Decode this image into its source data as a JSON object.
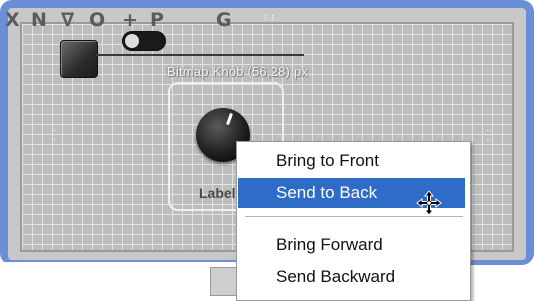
{
  "canvas": {
    "widget_caption": "Bitmap Knob (56,28) px",
    "knob_label": "Label"
  },
  "toolbar": {
    "tools": [
      "X",
      "N",
      "∇",
      "O",
      "+",
      "P",
      "G"
    ],
    "active_tool": "G"
  },
  "context_menu": {
    "items": [
      {
        "label": "Bring to Front"
      },
      {
        "label": "Send to Back"
      },
      {
        "label": "Bring Forward"
      },
      {
        "label": "Send Backward"
      }
    ],
    "highlighted": "Send to Back"
  },
  "colors": {
    "frame_blue": "#6b8fd6",
    "highlight_blue": "#2f6cc8"
  },
  "icons": {
    "cursor": "move-cursor-icon"
  }
}
